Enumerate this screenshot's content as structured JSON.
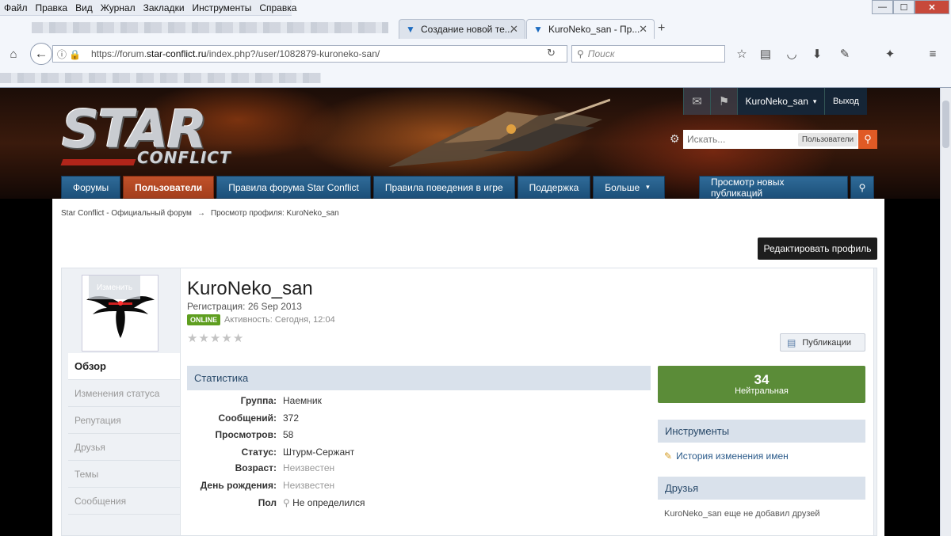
{
  "browser": {
    "menu": [
      "Файл",
      "Правка",
      "Вид",
      "Журнал",
      "Закладки",
      "Инструменты",
      "Справка"
    ],
    "menu_underline": [
      "Ф",
      "П",
      "В",
      "Ж",
      "З",
      "И",
      "С"
    ],
    "window_buttons": {
      "minimize": "—",
      "maximize": "☐",
      "close": "✕"
    },
    "tabs": [
      {
        "title": "Создание новой те...",
        "close": "✕"
      },
      {
        "title": "KuroNeko_san - Пр...",
        "close": "✕"
      }
    ],
    "new_tab": "+",
    "url": {
      "prefix": "https://forum.",
      "host": "star-conflict.ru",
      "path": "/index.php?/user/1082879-kuroneko-san/"
    },
    "search_placeholder": "Поиск"
  },
  "header": {
    "logo_main": "STAR",
    "logo_sub": "CONFLICT",
    "username": "KuroNeko_san",
    "username_caret": "▾",
    "logout": "Выход",
    "search_placeholder": "Искать...",
    "search_scope": "Пользователи"
  },
  "nav": {
    "items": [
      "Форумы",
      "Пользователи",
      "Правила форума Star Conflict",
      "Правила поведения в игре",
      "Поддержка",
      "Больше"
    ],
    "more_caret": "▾",
    "right": "Просмотр новых публикаций"
  },
  "breadcrumb": {
    "home": "Star Conflict - Официальный форум",
    "sep": "→",
    "current": "Просмотр профиля: KuroNeko_san"
  },
  "edit_profile": "Редактировать профиль",
  "profile": {
    "change_photo": "Изменить",
    "name": "KuroNeko_san",
    "registration_label": "Регистрация:",
    "registration_date": "26 Sep 2013",
    "online_badge": "ONLINE",
    "activity": "Активность: Сегодня, 12:04",
    "rating_stars": 0,
    "publications_button": "Публикации",
    "tabs": [
      "Обзор",
      "Изменения статуса",
      "Репутация",
      "Друзья",
      "Темы",
      "Сообщения"
    ]
  },
  "stats": {
    "title": "Статистика",
    "rows": [
      {
        "key": "Группа:",
        "value": "Наемник",
        "muted": false
      },
      {
        "key": "Сообщений:",
        "value": "372",
        "muted": false
      },
      {
        "key": "Просмотров:",
        "value": "58",
        "muted": false
      },
      {
        "key": "Статус:",
        "value": "Штурм-Сержант",
        "muted": false
      },
      {
        "key": "Возраст:",
        "value": "Неизвестен",
        "muted": true
      },
      {
        "key": "День рождения:",
        "value": "Неизвестен",
        "muted": true
      },
      {
        "key": "Пол",
        "value": "Не определился",
        "muted": false
      }
    ]
  },
  "reputation": {
    "value": "34",
    "label": "Нейтральная"
  },
  "tools": {
    "title": "Инструменты",
    "link": "История изменения имен"
  },
  "friends": {
    "title": "Друзья",
    "text": "KuroNeko_san еще не добавил друзей"
  },
  "colors": {
    "nav_active": "#b2461f",
    "nav": "#245b86",
    "reputation": "#5b8c38",
    "online": "#5e9e1f",
    "search_go": "#e05a25"
  }
}
